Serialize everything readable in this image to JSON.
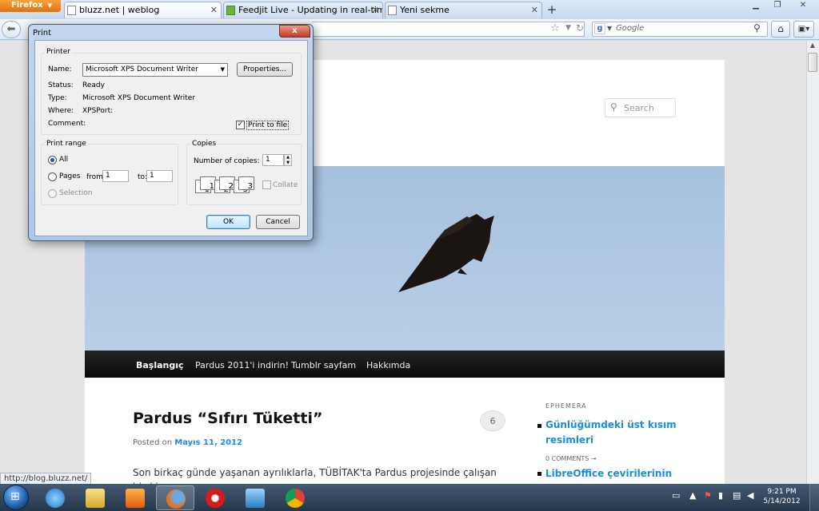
{
  "browser": {
    "app_button": "Firefox",
    "tabs": [
      {
        "label": "bluzz.net | weblog",
        "active": true
      },
      {
        "label": "Feedjit Live - Updating in real-time",
        "active": false
      },
      {
        "label": "Yeni sekme",
        "active": false
      }
    ],
    "new_tab": "+",
    "search_placeholder": "Google",
    "status_url": "http://blog.bluzz.net/"
  },
  "page": {
    "search_placeholder": "Search",
    "nav": [
      "Başlangıç",
      "Pardus 2011'i indirin!",
      "Tumblr sayfam",
      "Hakkımda"
    ],
    "post": {
      "title": "Pardus “Sıfırı Tüketti”",
      "posted_on_label": "Posted on",
      "date": "Mayıs 11, 2012",
      "comment_count": "6",
      "excerpt": "Son birkaç günde yaşanan ayrılıklarla, TÜBİTAK'ta Pardus projesinde çalışan hiç kimse"
    },
    "sidebar": {
      "widget_title": "EPHEMERA",
      "item1_line1": "Günlüğümdeki üst kısım",
      "item1_line2": "resimleri",
      "comments": "0 COMMENTS →",
      "item2": "LibreOffice çevirilerinin"
    }
  },
  "dialog": {
    "title": "Print",
    "close": "x",
    "printer_group": "Printer",
    "name_label": "Name:",
    "name_value": "Microsoft XPS Document Writer",
    "properties_button": "Properties...",
    "status_label": "Status:",
    "status_value": "Ready",
    "type_label": "Type:",
    "type_value": "Microsoft XPS Document Writer",
    "where_label": "Where:",
    "where_value": "XPSPort:",
    "comment_label": "Comment:",
    "print_to_file": "Print to file",
    "print_to_file_checked": true,
    "range_group": "Print range",
    "range_all": "All",
    "range_pages": "Pages",
    "from_label": "from:",
    "from_value": "1",
    "to_label": "to:",
    "to_value": "1",
    "range_selection": "Selection",
    "copies_group": "Copies",
    "copies_label": "Number of copies:",
    "copies_value": "1",
    "collate_label": "Collate",
    "collate_pages": [
      "1",
      "1",
      "2",
      "2",
      "3",
      "3"
    ],
    "ok_button": "OK",
    "cancel_button": "Cancel"
  },
  "taskbar": {
    "time": "9:21 PM",
    "date": "5/14/2012"
  }
}
